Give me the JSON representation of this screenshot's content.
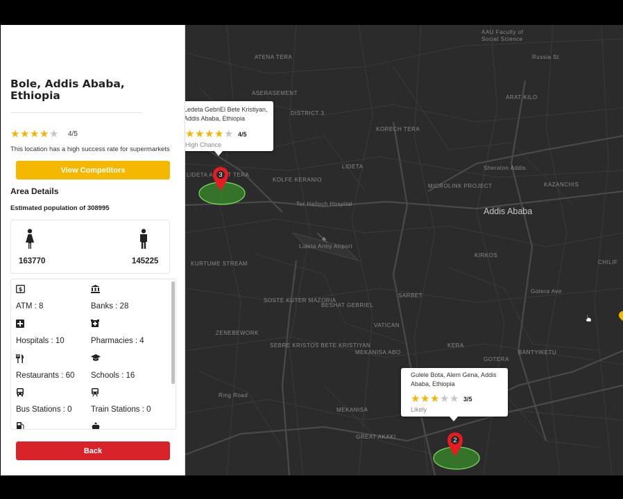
{
  "location": {
    "title": "Bole, Addis Ababa, Ethiopia",
    "rating": 4,
    "rating_max": 5,
    "rating_text": "4/5",
    "subtitle": "This location has a high success rate for supermarkets"
  },
  "buttons": {
    "view_competitors": "View Competitors",
    "back": "Back"
  },
  "area": {
    "title": "Area Details",
    "population_text": "Estimated population of 308995",
    "female_icon": "female-icon",
    "male_icon": "male-icon",
    "female_count": "163770",
    "male_count": "145225"
  },
  "facilities": [
    {
      "icon": "atm-icon",
      "label": "ATM : 8"
    },
    {
      "icon": "bank-icon",
      "label": "Banks : 28"
    },
    {
      "icon": "hospital-icon",
      "label": "Hospitals : 10"
    },
    {
      "icon": "pharmacy-icon",
      "label": "Pharmacies : 4"
    },
    {
      "icon": "restaurant-icon",
      "label": "Restaurants : 60"
    },
    {
      "icon": "school-icon",
      "label": "Schools : 16"
    },
    {
      "icon": "bus-icon",
      "label": "Bus Stations : 0"
    },
    {
      "icon": "train-icon",
      "label": "Train Stations : 0"
    },
    {
      "icon": "fuel-icon",
      "label": ""
    },
    {
      "icon": "place-of-worship-icon",
      "label": ""
    }
  ],
  "map": {
    "city_label": "Addis Ababa",
    "labels": [
      "AAU Faculty of",
      "Social Science",
      "ATENA TERA",
      "ASERASEMENT",
      "DISTRICT 3",
      "KORECH TERA",
      "ARAT KILO",
      "LIDETA",
      "KOLFE KERANIO",
      "LIDETA ARERIT TERA",
      "Tor Hailoch Hospital",
      "Sheraton Addis",
      "MICROLINK PROJECT",
      "KAZANCHIS",
      "Lideta Army Airport",
      "KURTUME STREAM",
      "KIRKOS",
      "SOSTE KUTER MAZORIA",
      "BESHAT GEBRIEL",
      "SARBET",
      "VATICAN",
      "ZENEBEWORK",
      "SEBRE KRISTOS BETE KRISTIYAN",
      "MEKANISA ABO",
      "KERA",
      "GOTERA",
      "BANTYIKETU",
      "Ring Road",
      "MEKANISA",
      "GREAT AKAKI",
      "CHILIF",
      "Gotera Ave",
      "Russia St"
    ],
    "markers": [
      {
        "count": "3",
        "address": "Ledeta GebriEl Bete Kristiyan, Addis Ababa, Ethiopia",
        "rating": 4,
        "rating_text": "4/5",
        "chance": "High Chance"
      },
      {
        "count": "2",
        "address": "Gulele Bota, Alem Gena, Addis Ababa, Ethiopia",
        "rating": 3,
        "rating_text": "3/5",
        "chance": "Likely"
      }
    ]
  },
  "colors": {
    "accent_yellow": "#f5b800",
    "accent_red": "#d8232a",
    "star_on": "#f4b400",
    "star_off": "#c6c6c6",
    "map_bg": "#2b2b2b",
    "zone_green": "#3fae2a"
  }
}
